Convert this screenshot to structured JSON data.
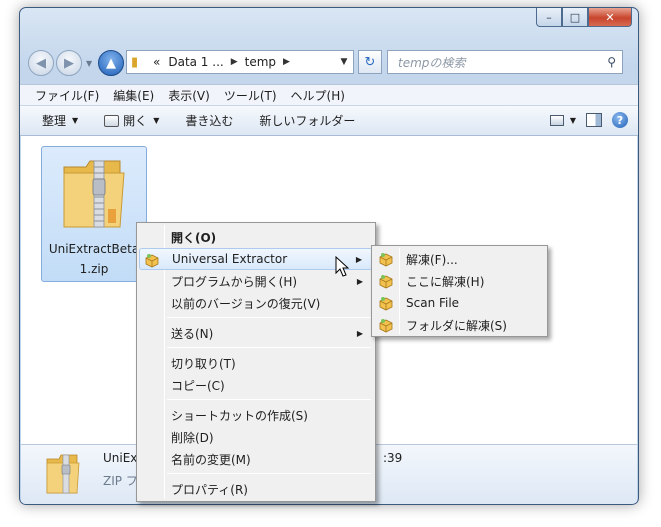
{
  "window": {
    "caption_buttons": [
      "minimize-icon",
      "maximize-icon",
      "close-icon"
    ]
  },
  "navigation": {
    "back_icon": "back-arrow-icon",
    "forward_icon": "forward-arrow-icon",
    "up_icon": "up-arrow-icon",
    "address": {
      "overflow": "«",
      "segments": [
        "Data 1 ...",
        "temp"
      ]
    },
    "search_placeholder": "tempの検索"
  },
  "menubar": {
    "items": [
      "ファイル(F)",
      "編集(E)",
      "表示(V)",
      "ツール(T)",
      "ヘルプ(H)"
    ]
  },
  "toolbar": {
    "organize": "整理",
    "open": "開く",
    "burn": "書き込む",
    "new_folder": "新しいフォルダー"
  },
  "file": {
    "name_line1": "UniExtractBeta",
    "name_line2": "1.zip"
  },
  "details": {
    "name": "UniEx",
    "type": "ZIP フ",
    "time": ":39"
  },
  "context_menu": {
    "items": [
      {
        "label": "開く(O)",
        "bold": true
      },
      {
        "label": "Universal Extractor",
        "submenu": true,
        "icon": "universal-extractor-icon",
        "highlighted": true
      },
      {
        "label": "プログラムから開く(H)",
        "submenu": true
      },
      {
        "label": "以前のバージョンの復元(V)"
      },
      {
        "label": "送る(N)",
        "submenu": true
      },
      {
        "label": "切り取り(T)"
      },
      {
        "label": "コピー(C)"
      },
      {
        "label": "ショートカットの作成(S)"
      },
      {
        "label": "削除(D)"
      },
      {
        "label": "名前の変更(M)"
      },
      {
        "label": "プロパティ(R)"
      }
    ]
  },
  "submenu": {
    "items": [
      {
        "label": "解凍(F)...",
        "icon": "universal-extractor-icon"
      },
      {
        "label": "ここに解凍(H)",
        "icon": "universal-extractor-icon"
      },
      {
        "label": "Scan File",
        "icon": "universal-extractor-icon"
      },
      {
        "label": "フォルダに解凍(S)",
        "icon": "universal-extractor-icon"
      }
    ]
  },
  "colors": {
    "window_frame": "#c3d6ec",
    "selection": "#c2dcf7",
    "menu_bg": "#f0f0f0"
  }
}
